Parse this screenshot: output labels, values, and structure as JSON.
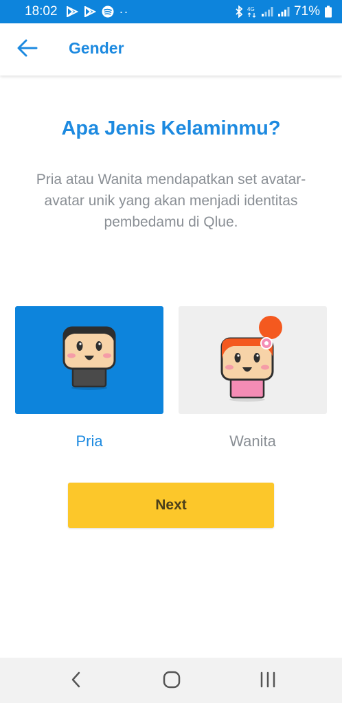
{
  "status_bar": {
    "time": "18:02",
    "battery": "71%",
    "icons": [
      "play-store-icon",
      "play-store-icon",
      "spotify-icon",
      "more-dots-icon",
      "bluetooth-icon",
      "4g-icon",
      "signal-icon",
      "signal-icon",
      "battery-icon"
    ]
  },
  "app_bar": {
    "title": "Gender",
    "back_icon": "arrow-left-icon"
  },
  "main": {
    "heading": "Apa Jenis Kelaminmu?",
    "description": "Pria atau Wanita mendapatkan set avatar-avatar unik yang akan menjadi identitas pembedamu di Qlue.",
    "options": [
      {
        "label": "Pria",
        "selected": true,
        "avatar": "male-avatar"
      },
      {
        "label": "Wanita",
        "selected": false,
        "avatar": "female-avatar"
      }
    ],
    "next_label": "Next"
  },
  "nav_bar": {
    "icons": [
      "nav-back-icon",
      "nav-home-icon",
      "nav-recent-icon"
    ]
  },
  "colors": {
    "primary": "#0d84dc",
    "heading": "#1d8ae0",
    "button": "#fcc72a",
    "unselected_card": "#efefef",
    "muted_text": "#8a8f95"
  }
}
